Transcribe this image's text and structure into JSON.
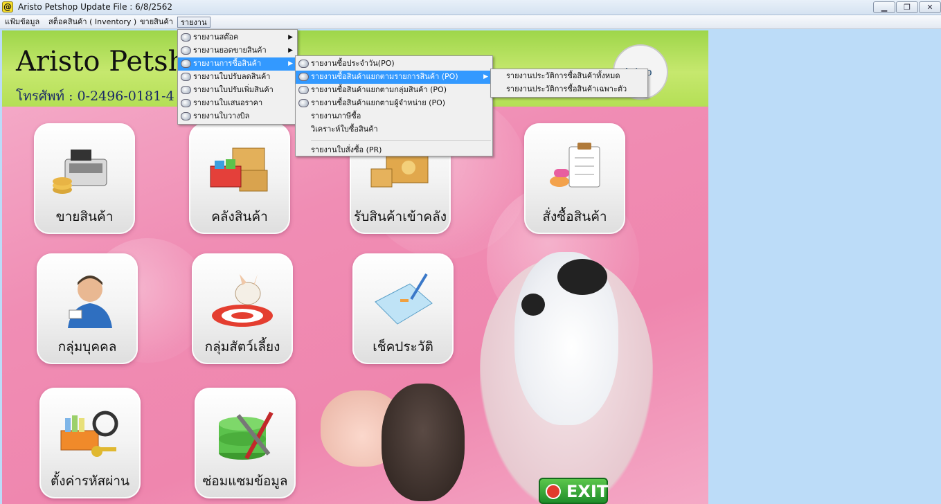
{
  "window": {
    "title": "Aristo Petshop  Update File : 6/8/2562",
    "app_icon": "@",
    "controls": {
      "minimize": "▁",
      "restore": "❐",
      "close": "✕"
    }
  },
  "menubar": [
    {
      "label": "แฟ้มข้อมูล"
    },
    {
      "label": "สต็อคสินค้า ( Inventory )"
    },
    {
      "label": "ขายสินค้า"
    },
    {
      "label": "รายงาน"
    }
  ],
  "header": {
    "brand": "Aristo Petshop",
    "phone": "โทรศัพท์ : 0-2496-0181-4",
    "logo_text": "Aristo"
  },
  "tiles": [
    {
      "label": "ขายสินค้า",
      "icon": "cash-register-icon"
    },
    {
      "label": "คลังสินค้า",
      "icon": "warehouse-boxes-icon"
    },
    {
      "label": "รับสินค้าเข้าคลัง",
      "icon": "receive-goods-icon"
    },
    {
      "label": "สั่งซื้อสินค้า",
      "icon": "purchase-order-icon"
    },
    {
      "label": "กลุ่มบุคคล",
      "icon": "person-icon"
    },
    {
      "label": "กลุ่มสัตว์เลี้ยง",
      "icon": "pet-dog-icon"
    },
    {
      "label": "เช็คประวัติ",
      "icon": "history-clipboard-icon"
    },
    {
      "label": "ตั้งค่ารหัสผ่าน",
      "icon": "password-keys-icon"
    },
    {
      "label": "ซ่อมแซมข้อมูล",
      "icon": "database-repair-icon"
    }
  ],
  "exit_label": "EXIT",
  "report_menu": [
    {
      "label": "รายงานสต๊อค",
      "submenu": true
    },
    {
      "label": "รายงานยอดขายสินค้า",
      "submenu": true
    },
    {
      "label": "รายงานการซื้อสินค้า",
      "submenu": true,
      "highlighted": true
    },
    {
      "label": "รายงานใบปรับลดสินค้า"
    },
    {
      "label": "รายงานใบปรับเพิ่มสินค้า"
    },
    {
      "label": "รายงานใบเสนอราคา"
    },
    {
      "label": "รายงานใบวางบิล"
    }
  ],
  "purchase_menu": [
    {
      "label": "รายงานซื้อประจำวัน(PO)",
      "icon": true
    },
    {
      "label": "รายงานซื้อสินค้าแยกตามรายการสินค้า (PO)",
      "icon": true,
      "submenu": true,
      "highlighted": true
    },
    {
      "label": "รายงานซื้อสินค้าแยกตามกลุ่มสินค้า (PO)",
      "icon": true
    },
    {
      "label": "รายงานซื้อสินค้าแยกตามผู้จำหน่าย (PO)",
      "icon": true
    },
    {
      "label": "รายงานภาษีซื้อ"
    },
    {
      "label": "วิเคราะห์ใบซื้อสินค้า"
    },
    {
      "label": "รายงานใบสั่งซื้อ (PR)",
      "after_separator": true
    }
  ],
  "item_menu": [
    {
      "label": "รายงานประวัติการซื้อสินค้าทั้งหมด"
    },
    {
      "label": "รายงานประวัติการซื้อสินค้าเฉพาะตัว"
    }
  ],
  "colors": {
    "menu_highlight": "#3399ff",
    "header_green": "#9ed64a",
    "main_pink": "#f08db4",
    "exit_green": "#1f8d2a"
  }
}
